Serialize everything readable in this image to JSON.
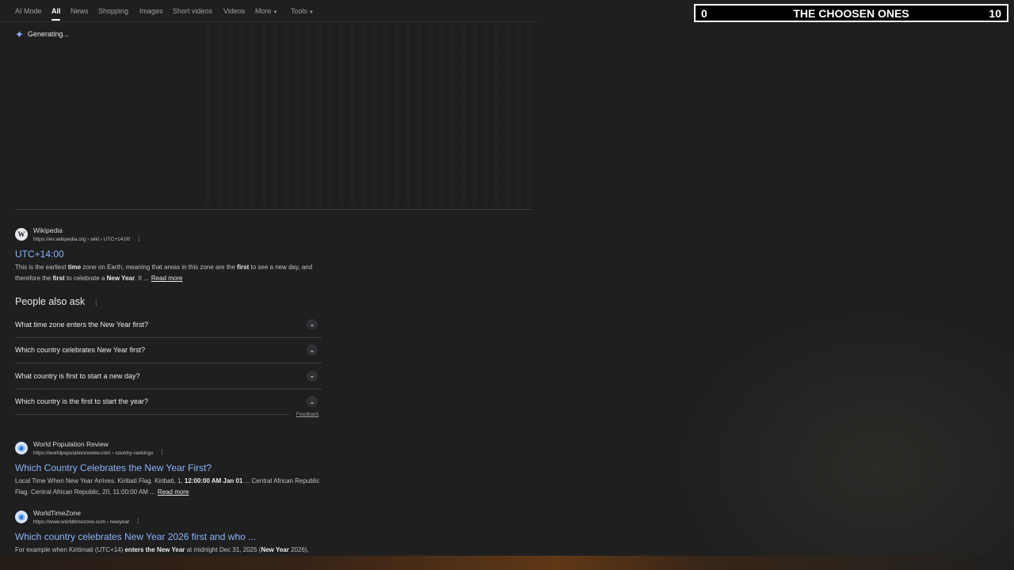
{
  "nav": {
    "ai_mode": "AI Mode",
    "all": "All",
    "news": "News",
    "shopping": "Shopping",
    "images": "Images",
    "short_videos": "Short videos",
    "videos": "Videos",
    "more": "More",
    "tools": "Tools"
  },
  "ai_overview": {
    "status": "Generating..."
  },
  "results": [
    {
      "site": "Wikipedia",
      "url": "https://en.wikipedia.org › wiki › UTC+14:00",
      "title": "UTC+14:00",
      "favicon": "W",
      "snippet_html": "This is the earliest <b>time</b> zone on Earth, meaning that areas in this zone are the <b>first</b> to see a new day, and therefore the <b>first</b> to celebrate a <b>New Year</b>. It ...",
      "read_more": "Read more"
    },
    {
      "site": "World Population Review",
      "url": "https://worldpopulationreview.com › country-rankings",
      "title": "Which Country Celebrates the New Year First?",
      "favicon": "◉",
      "snippet_html": "Local Time When New Year Arrives. Kiribati Flag. Kiribati, 1, <b>12:00:00 AM Jan 01</b> ... Central African Republic Flag. Central African Republic, 20, 11:00:00 AM ...",
      "read_more": "Read more"
    },
    {
      "site": "WorldTimeZone",
      "url": "https://www.worldtimezone.com › newyear",
      "title": "Which country celebrates New Year 2026 first and who ...",
      "favicon": "◉",
      "snippet_html": "For example when Kiritimati (UTC+14) <b>enters the New Year</b> at midnight Dec 31, 2025 (<b>New Year</b> 2026),",
      "read_more": ""
    }
  ],
  "people_also_ask": {
    "title": "People also ask",
    "questions": [
      "What time zone enters the New Year first?",
      "Which country celebrates New Year first?",
      "What country is first to start a new day?",
      "Which country is the first to start the year?"
    ],
    "feedback": "Feedback"
  },
  "scoreboard": {
    "left": "0",
    "title": "THE CHOOSEN ONES",
    "right": "10"
  },
  "icons": {
    "spark": "sparkle-icon",
    "kebab": "kebab-menu-icon",
    "chevron": "chevron-down-icon"
  }
}
